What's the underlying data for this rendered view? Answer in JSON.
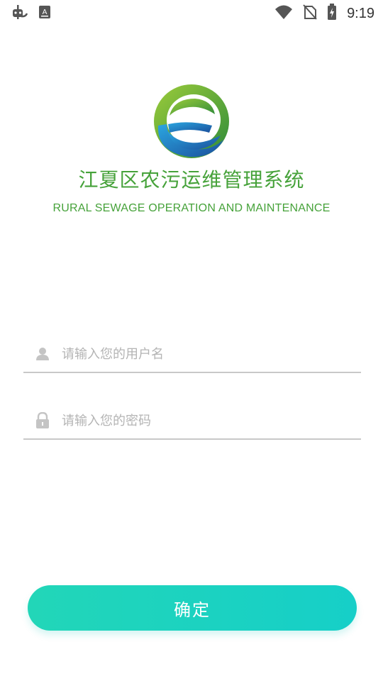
{
  "status_bar": {
    "time": "9:19",
    "icons": [
      "bug-icon",
      "keyboard-a-icon",
      "wifi-icon",
      "no-sim-icon",
      "battery-charging-icon"
    ]
  },
  "header": {
    "logo": "e-logo-icon",
    "title": "江夏区农污运维管理系统",
    "subtitle": "RURAL SEWAGE OPERATION AND MAINTENANCE"
  },
  "login": {
    "username_placeholder": "请输入您的用户名",
    "username_value": "",
    "username_icon": "user-icon",
    "password_placeholder": "请输入您的密码",
    "password_value": "",
    "password_icon": "lock-icon",
    "confirm_label": "确定"
  },
  "colors": {
    "brand_green": "#46a23a",
    "button_start": "#22d6b8",
    "button_end": "#16cfc8",
    "underline": "#c8c8c8"
  }
}
